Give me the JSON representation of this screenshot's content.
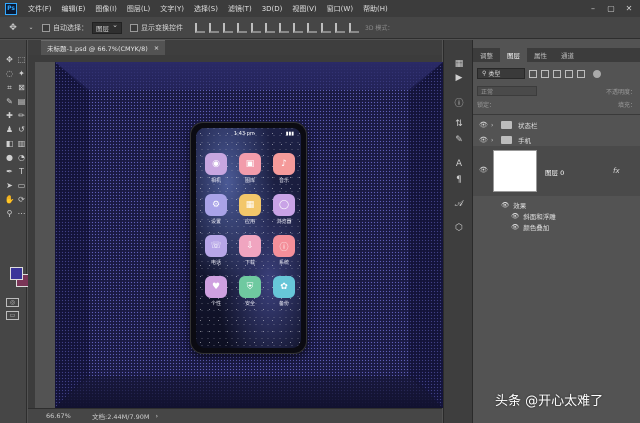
{
  "app": {
    "menu": [
      "文件(F)",
      "编辑(E)",
      "图像(I)",
      "图层(L)",
      "文字(Y)",
      "选择(S)",
      "滤镜(T)",
      "3D(D)",
      "视图(V)",
      "窗口(W)",
      "帮助(H)"
    ],
    "logo_text": "Ps"
  },
  "options": {
    "auto_select_label": "自动选择：",
    "auto_select_value": "图层",
    "show_transform_label": "显示变换控件",
    "mode3d_label": "3D 模式："
  },
  "document": {
    "tab_title": "未标题-1.psd @ 66.7%(CMYK/8)",
    "tab_close": "×"
  },
  "phone": {
    "time": "1:43 pm",
    "battery": "▮▮▮",
    "apps": [
      {
        "label": "相机",
        "glyph": "◉",
        "color": "#c7a6e0"
      },
      {
        "label": "图库",
        "glyph": "▣",
        "color": "#f29cab"
      },
      {
        "label": "音乐",
        "glyph": "♪",
        "color": "#f59a9a"
      },
      {
        "label": "设置",
        "glyph": "⚙",
        "color": "#a9a3e8"
      },
      {
        "label": "应用",
        "glyph": "▦",
        "color": "#f3c76a"
      },
      {
        "label": "浏览器",
        "glyph": "◯",
        "color": "#c9a3e6"
      },
      {
        "label": "电话",
        "glyph": "☏",
        "color": "#b7a6e8"
      },
      {
        "label": "下载",
        "glyph": "⇩",
        "color": "#f0a5c0"
      },
      {
        "label": "系统",
        "glyph": "ⓘ",
        "color": "#f48f9a"
      },
      {
        "label": "个性",
        "glyph": "♥",
        "color": "#cfa0e0"
      },
      {
        "label": "安全",
        "glyph": "⛨",
        "color": "#6fc9a0"
      },
      {
        "label": "备份",
        "glyph": "✿",
        "color": "#67c6d8"
      }
    ]
  },
  "layers_panel": {
    "tabs": [
      "调整",
      "图层",
      "属性",
      "通道"
    ],
    "active_tab": "图层",
    "filter_label": "类型",
    "blend_mode": "正常",
    "opacity_label": "不透明度：",
    "lock_label": "锁定：",
    "fill_label": "填充：",
    "layers": [
      {
        "name": "状态栏",
        "type": "group"
      },
      {
        "name": "手机",
        "type": "group"
      }
    ],
    "layer0_name": "图层 0",
    "fx_label": "fx",
    "effects_label": "效果",
    "effects": [
      "斜面和浮雕",
      "颜色叠加"
    ]
  },
  "status": {
    "zoom": "66.67%",
    "doc_size": "文档:2.44M/7.90M",
    "arrow": "›"
  },
  "watermark": "头条 @开心太难了",
  "colors": {
    "foreground": "#3a3499",
    "background": "#7a3557"
  }
}
